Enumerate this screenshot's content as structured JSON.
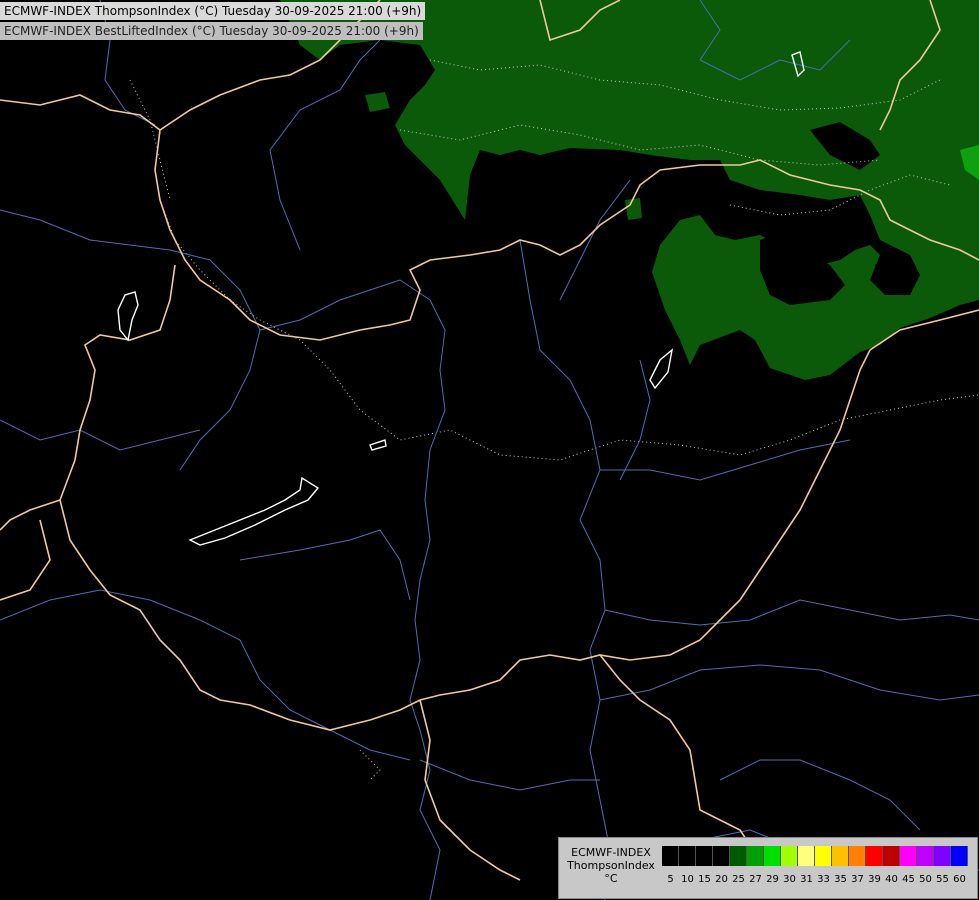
{
  "header": {
    "line1": "ECMWF-INDEX ThompsonIndex (°C) Tuesday 30-09-2025 21:00 (+9h)",
    "line2": "ECMWF-INDEX BestLiftedIndex (°C) Tuesday 30-09-2025 21:00 (+9h)"
  },
  "legend": {
    "line1": "ECMWF-INDEX",
    "line2": "ThompsonIndex",
    "unit": "°C",
    "ticks": [
      "5",
      "10",
      "15",
      "20",
      "25",
      "27",
      "29",
      "30",
      "31",
      "33",
      "35",
      "37",
      "39",
      "40",
      "45",
      "50",
      "55",
      "60"
    ],
    "colors": [
      "#000000",
      "#000000",
      "#000000",
      "#000000",
      "#005a00",
      "#00a000",
      "#00e000",
      "#a0ff00",
      "#ffff80",
      "#ffff00",
      "#ffc000",
      "#ff8000",
      "#ff0000",
      "#c00000",
      "#ff00ff",
      "#c000ff",
      "#8000ff",
      "#0000ff"
    ]
  },
  "map": {
    "background": "#000000",
    "field_color": "#0a5a0a",
    "border_color": "#f2c89a",
    "river_color": "#4a6fb5",
    "lake_color": "#ffffff"
  }
}
